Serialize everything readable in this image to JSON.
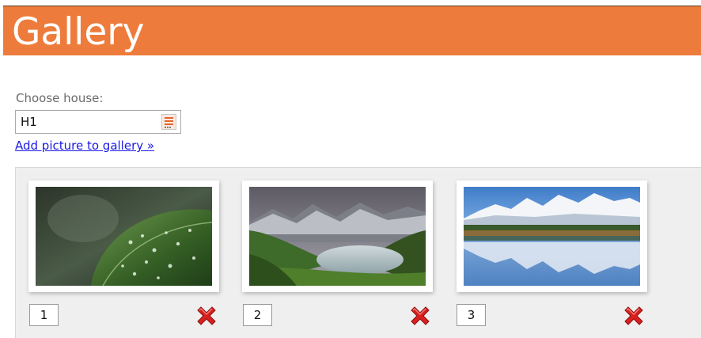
{
  "header": {
    "title": "Gallery"
  },
  "form": {
    "label": "Choose house:",
    "house_value": "H1",
    "add_link": "Add picture to gallery »"
  },
  "gallery": {
    "items": [
      {
        "number": "1",
        "image": "leaf-with-water-drops"
      },
      {
        "number": "2",
        "image": "mountain-valley-lake"
      },
      {
        "number": "3",
        "image": "snowy-mountains-lake-reflection"
      }
    ]
  },
  "colors": {
    "header_bg": "#ed7c3c",
    "link": "#1a1ae6",
    "delete": "#d8201e"
  }
}
